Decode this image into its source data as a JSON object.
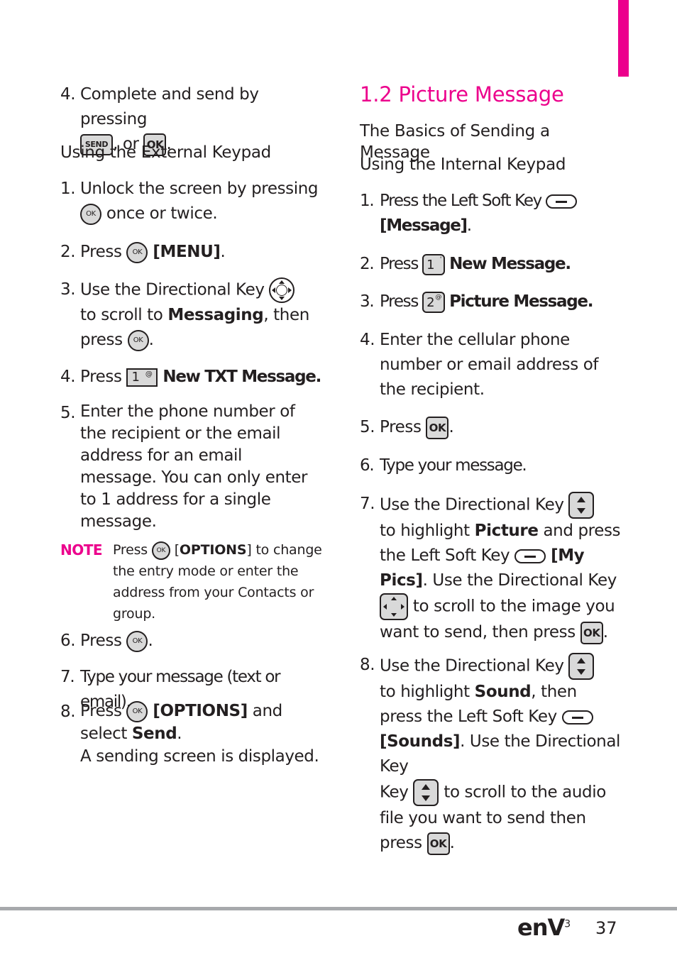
{
  "colors": {
    "accent": "#ec008c",
    "text": "#231f20",
    "rule": "#a7a9ac"
  },
  "left": {
    "step4_top": {
      "num": "4.",
      "text_a": "Complete and send by pressing",
      "key1": "SEND",
      "text_b": ", or",
      "key2": "OK",
      "text_c": "."
    },
    "heading_external": "Using the External Keypad",
    "steps": [
      {
        "num": "1.",
        "text_a": "Unlock the screen by pressing",
        "text_b": "once or twice."
      },
      {
        "num": "2.",
        "text_a": "Press",
        "bold": "[MENU]",
        "text_b": "."
      },
      {
        "num": "3.",
        "text_a": "Use the Directional Key",
        "text_b": "to scroll to",
        "bold": "Messaging",
        "text_c": ", then press",
        "text_d": "."
      },
      {
        "num": "4.",
        "text_a": "Press",
        "key": "1",
        "bold": "New TXT Message."
      },
      {
        "num": "5.",
        "text_a": "Enter the phone number of the recipient or the email address for an email message. You can only enter to 1 address for a single message."
      },
      {
        "num": "6.",
        "text_a": "Press",
        "text_b": "."
      },
      {
        "num": "7.",
        "text_a": "Type your message (text or email)."
      },
      {
        "num": "8.",
        "text_a": "Press",
        "bold": "[OPTIONS]",
        "text_b": "and select",
        "bold2": "Send",
        "text_c": ".",
        "text_d": "A sending screen is displayed."
      }
    ],
    "note": {
      "label": "NOTE",
      "text_a": "Press",
      "bold": "OPTIONS",
      "text_b": "to change the entry mode or enter the address from your Contacts or group."
    }
  },
  "right": {
    "section_title": "1.2 Picture Message",
    "heading_basics": "The Basics of Sending a Message",
    "heading_internal": "Using the Internal Keypad",
    "steps": [
      {
        "num": "1.",
        "text_a": "Press the Left Soft Key",
        "bold": "[Message]",
        "text_b": "."
      },
      {
        "num": "2.",
        "text_a": "Press",
        "key": "1",
        "key_sup": "'",
        "bold": "New Message."
      },
      {
        "num": "3.",
        "text_a": "Press",
        "key": "2",
        "key_sup": "@",
        "bold": "Picture Message."
      },
      {
        "num": "4.",
        "text_a": "Enter the cellular phone number or email address of the recipient."
      },
      {
        "num": "5.",
        "text_a": "Press",
        "key": "OK",
        "text_b": "."
      },
      {
        "num": "6.",
        "text_a": "Type your message."
      },
      {
        "num": "7.",
        "text_a": "Use the Directional Key",
        "text_b": "to highlight",
        "bold": "Picture",
        "text_c": "and press the Left Soft Key",
        "bold2": "[My Pics]",
        "text_d": ". Use the Directional Key",
        "text_e": "to scroll to the image you want to send, then press",
        "key": "OK",
        "text_f": "."
      },
      {
        "num": "8.",
        "text_a": "Use the Directional Key",
        "text_b": "to highlight",
        "bold": "Sound",
        "text_c": ", then press the Left Soft Key",
        "bold2": "[Sounds]",
        "text_d": ". Use the Directional Key",
        "text_e": "to scroll to the audio file you want to send then press",
        "key": "OK",
        "text_f": "."
      }
    ]
  },
  "footer": {
    "brand": "enV",
    "brand_sup": "3",
    "page_number": "37"
  }
}
